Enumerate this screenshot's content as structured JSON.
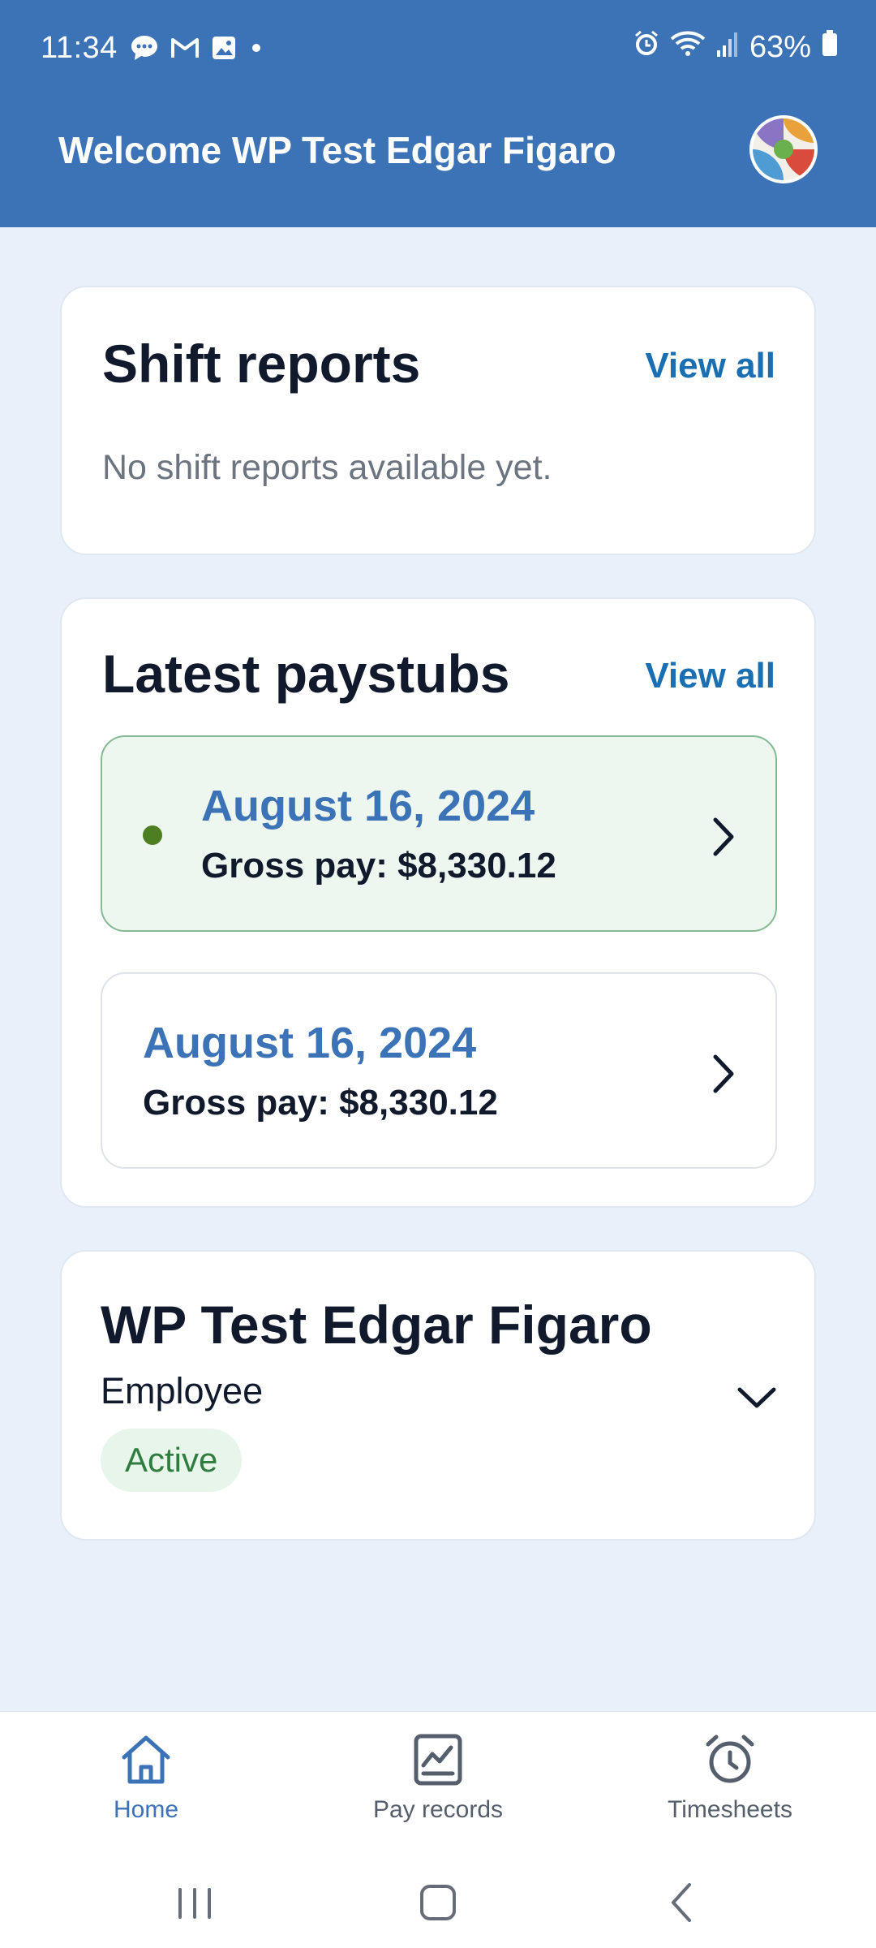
{
  "status_bar": {
    "time": "11:34",
    "notification_icons": [
      "chat-bubble-icon",
      "gmail-icon",
      "gallery-icon",
      "dot-icon"
    ],
    "system_icons": [
      "alarm-icon",
      "wifi-icon",
      "signal-icon"
    ],
    "battery": "63%"
  },
  "header": {
    "title": "Welcome WP Test Edgar Figaro",
    "background": "#3c73b7"
  },
  "shift_reports": {
    "title": "Shift reports",
    "view_all": "View all",
    "empty_message": "No shift reports available yet."
  },
  "paystubs": {
    "title": "Latest paystubs",
    "view_all": "View all",
    "items": [
      {
        "date": "August 16, 2024",
        "gross": "Gross pay: $8,330.12",
        "highlighted": true
      },
      {
        "date": "August 16, 2024",
        "gross": "Gross pay: $8,330.12",
        "highlighted": false
      }
    ]
  },
  "profile": {
    "name": "WP Test Edgar Figaro",
    "role": "Employee",
    "status": "Active"
  },
  "bottom_nav": {
    "items": [
      {
        "label": "Home",
        "icon": "home-icon",
        "active": true
      },
      {
        "label": "Pay records",
        "icon": "chart-icon",
        "active": false
      },
      {
        "label": "Timesheets",
        "icon": "alarm-clock-icon",
        "active": false
      }
    ]
  },
  "colors": {
    "accent": "#3c73b7",
    "link": "#1a6fb3",
    "highlight_bg": "#eef7ef",
    "status_green": "#2f7d3e"
  }
}
